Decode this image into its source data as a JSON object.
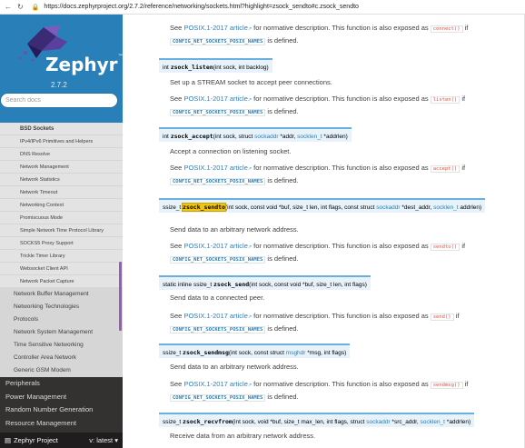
{
  "browser": {
    "url": "https://docs.zephyrproject.org/2.7.2/reference/networking/sockets.html?highlight=zsock_sendto#c.zsock_sendto",
    "back_icon": "arrow-left",
    "refresh_icon": "refresh",
    "lock_icon": "lock"
  },
  "sidebar": {
    "brand": "Zephyr",
    "trademark": "™",
    "version": "2.7.2",
    "search_placeholder": "Search docs",
    "sub_items": [
      "BSD Sockets",
      "IPv4/IPv6 Primitives and Helpers",
      "DNS Resolve",
      "Network Management",
      "Network Statistics",
      "Network Timeout",
      "Networking Context",
      "Promiscuous Mode",
      "Simple Network Time Protocol Library",
      "SOCKS5 Proxy Support",
      "Trickle Timer Library",
      "Websocket Client API",
      "Network Packet Capture"
    ],
    "l2_items": [
      "Network Buffer Management",
      "Networking Technologies",
      "Protocols",
      "Network System Management",
      "Time Sensitive Networking",
      "Controller Area Network",
      "Generic GSM Modem"
    ],
    "l1_items": [
      "Peripherals",
      "Power Management",
      "Random Number Generation",
      "Resource Management"
    ],
    "footer_project": "Zephyr Project",
    "footer_version": "v: latest",
    "colors": {
      "top": "#2980b9",
      "nav": "#343131",
      "scroll": "#9b59b6"
    }
  },
  "content": {
    "top_block": {
      "pre": "See ",
      "link": "POSIX.1-2017 article",
      "mid": " for normative description. This function is also exposed as ",
      "code": "connect()",
      "post": " if",
      "config": "CONFIG_NET_SOCKETS_POSIX_NAMES",
      "tail": " is defined."
    },
    "functions": [
      {
        "ret": "int",
        "name": "zsock_listen",
        "args": "(int sock, int backlog)",
        "summary": "Set up a STREAM socket to accept peer connections.",
        "alias": "listen()"
      },
      {
        "ret": "int",
        "name": "zsock_accept",
        "args_pre": "(int sock, struct ",
        "args_link1": "sockaddr",
        "args_mid": " *addr, ",
        "args_link2": "socklen_t",
        "args_post": " *addrlen)",
        "summary": "Accept a connection on listening socket.",
        "alias": "accept()"
      },
      {
        "ret": "ssize_t",
        "name": "zsock_sendto",
        "args_pre": "(int sock, const void *buf, size_t len, int flags, const struct ",
        "args_link1": "sockaddr",
        "args_mid": " *dest_addr, ",
        "args_link2": "socklen_t",
        "args_post": " addrlen)",
        "summary": "Send data to an arbitrary network address.",
        "alias": "sendto()"
      },
      {
        "ret": "static inline ssize_t",
        "name": "zsock_send",
        "args": "(int sock, const void *buf, size_t len, int flags)",
        "summary": "Send data to a connected peer.",
        "alias": "send()"
      },
      {
        "ret": "ssize_t",
        "name": "zsock_sendmsg",
        "args_pre": "(int sock, const struct ",
        "args_link1": "msghdr",
        "args_post": " *msg, int flags)",
        "summary": "Send data to an arbitrary network address.",
        "alias": "sendmsg()"
      },
      {
        "ret": "ssize_t",
        "name": "zsock_recvfrom",
        "args_pre": "(int sock, void *buf, size_t max_len, int flags, struct ",
        "args_link1": "sockaddr",
        "args_mid": " *src_addr, ",
        "args_link2": "socklen_t",
        "args_post": " *addrlen)",
        "summary": "Receive data from an arbitrary network address."
      }
    ],
    "see_pre": "See ",
    "see_link": "POSIX.1-2017 article",
    "see_mid": " for normative description. This function is also exposed as ",
    "see_if": " if",
    "config": "CONFIG_NET_SOCKETS_POSIX_NAMES",
    "defined": " is defined.",
    "ext_icon": "↗"
  }
}
